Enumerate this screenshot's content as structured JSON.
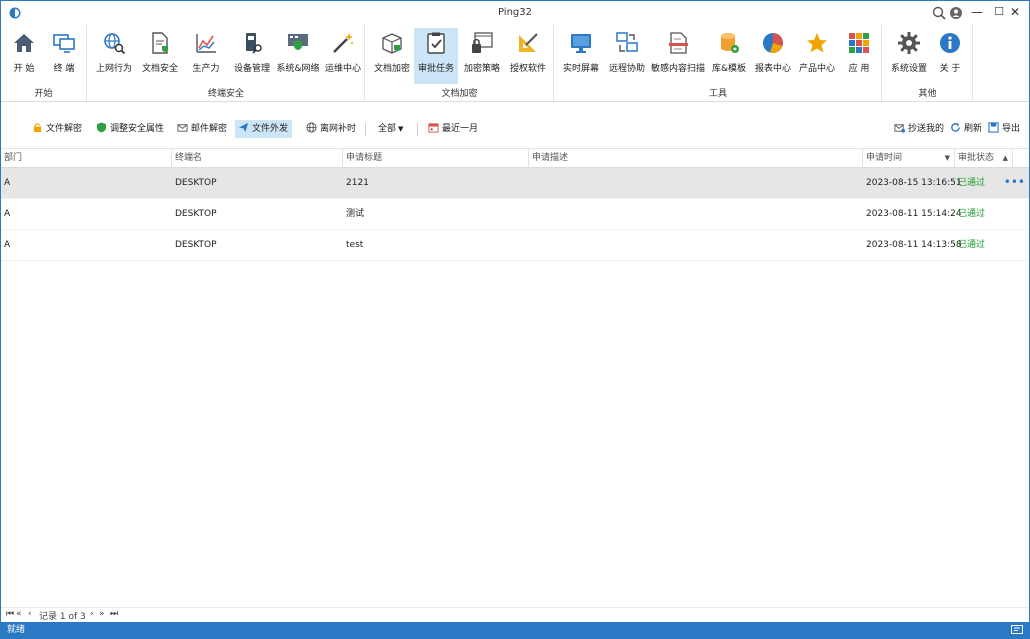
{
  "window": {
    "title": "Ping32",
    "minimize": "—",
    "maximize": "☐",
    "close": "✕"
  },
  "ribbon": {
    "groups": [
      {
        "label": "开始",
        "items": [
          {
            "label": "开  始",
            "icon": "home-icon"
          },
          {
            "label": "终  端",
            "icon": "terminal-icon"
          }
        ]
      },
      {
        "label": "终端安全",
        "items": [
          {
            "label": "上网行为",
            "icon": "web-behavior-icon"
          },
          {
            "label": "文档安全",
            "icon": "document-security-icon"
          },
          {
            "label": "生产力",
            "icon": "productivity-chart-icon"
          },
          {
            "label": "设备管理",
            "icon": "device-management-icon"
          },
          {
            "label": "系统&网络",
            "icon": "system-network-icon"
          },
          {
            "label": "运维中心",
            "icon": "magic-wand-icon"
          }
        ]
      },
      {
        "label": "文档加密",
        "items": [
          {
            "label": "文档加密",
            "icon": "document-encrypt-icon"
          },
          {
            "label": "审批任务",
            "icon": "approval-task-icon"
          },
          {
            "label": "加密策略",
            "icon": "encrypt-policy-icon"
          },
          {
            "label": "授权软件",
            "icon": "authorized-software-icon"
          }
        ]
      },
      {
        "label": "工具",
        "items": [
          {
            "label": "实时屏幕",
            "icon": "monitor-icon"
          },
          {
            "label": "远程协助",
            "icon": "remote-assist-icon"
          },
          {
            "label": "敏感内容扫描",
            "icon": "sensitive-scan-icon"
          },
          {
            "label": "库&模板",
            "icon": "database-icon"
          },
          {
            "label": "报表中心",
            "icon": "pie-chart-icon"
          },
          {
            "label": "产品中心",
            "icon": "star-icon"
          },
          {
            "label": "应  用",
            "icon": "apps-grid-icon"
          }
        ]
      },
      {
        "label": "其他",
        "items": [
          {
            "label": "系统设置",
            "icon": "gear-icon"
          },
          {
            "label": "关  于",
            "icon": "info-icon"
          }
        ]
      }
    ],
    "active_item": "审批任务"
  },
  "toolbar": {
    "items": [
      {
        "label": "文件解密",
        "icon": "lock-icon"
      },
      {
        "label": "调整安全属性",
        "icon": "shield-icon"
      },
      {
        "label": "邮件解密",
        "icon": "mail-icon"
      },
      {
        "label": "文件外发",
        "icon": "send-icon"
      },
      {
        "label": "离网补时",
        "icon": "globe-icon"
      }
    ],
    "filter_label": "全部",
    "date_label": "最近一月",
    "right": [
      {
        "label": "抄送我的",
        "icon": "cc-icon"
      },
      {
        "label": "刷新",
        "icon": "refresh-icon"
      },
      {
        "label": "导出",
        "icon": "export-icon"
      }
    ]
  },
  "grid": {
    "columns": [
      "部门",
      "终端名",
      "申请标题",
      "申请描述",
      "申请时间",
      "审批状态"
    ],
    "rows": [
      {
        "dept": "A",
        "terminal": "DESKTOP",
        "title": "2121",
        "desc": "",
        "time": "2023-08-15 13:16:51",
        "status": "已通过"
      },
      {
        "dept": "A",
        "terminal": "DESKTOP",
        "title": "测试",
        "desc": "",
        "time": "2023-08-11 15:14:24",
        "status": "已通过"
      },
      {
        "dept": "A",
        "terminal": "DESKTOP",
        "title": "test",
        "desc": "",
        "time": "2023-08-11 14:13:58",
        "status": "已通过"
      }
    ],
    "row_more": "•••"
  },
  "pager": {
    "first": "⏮",
    "prev_page": "«",
    "prev": "‹",
    "record_text": "记录 1 of 3",
    "next": "›",
    "next_page": "»",
    "last": "⏭"
  },
  "statusbar": {
    "text": "就绪"
  },
  "colors": {
    "accent": "#2b78c5",
    "selected_row": "#e6e6e6",
    "active_button": "#cde6f7",
    "status_ok": "#1d9b2c"
  }
}
